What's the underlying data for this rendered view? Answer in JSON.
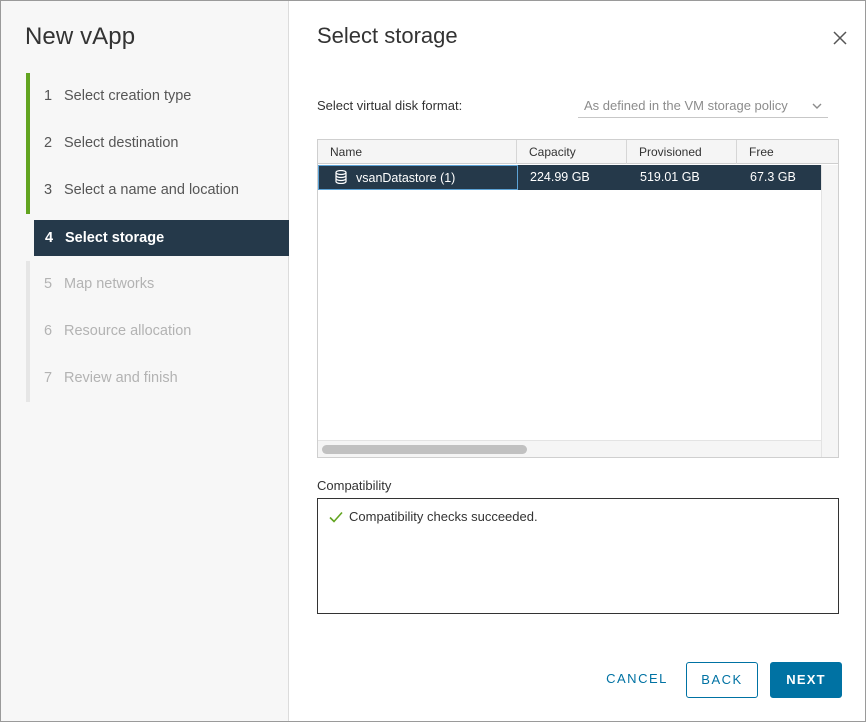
{
  "sidebar": {
    "title": "New vApp",
    "steps": [
      {
        "num": "1",
        "label": "Select creation type"
      },
      {
        "num": "2",
        "label": "Select destination"
      },
      {
        "num": "3",
        "label": "Select a name and location"
      },
      {
        "num": "4",
        "label": "Select storage"
      },
      {
        "num": "5",
        "label": "Map networks"
      },
      {
        "num": "6",
        "label": "Resource allocation"
      },
      {
        "num": "7",
        "label": "Review and finish"
      }
    ]
  },
  "main": {
    "title": "Select storage",
    "format_label": "Select virtual disk format:",
    "format_value": "As defined in the VM storage policy",
    "grid": {
      "columns": [
        "Name",
        "Capacity",
        "Provisioned",
        "Free"
      ],
      "rows": [
        {
          "name": "vsanDatastore (1)",
          "capacity": "224.99 GB",
          "provisioned": "519.01 GB",
          "free": "67.3 GB"
        }
      ]
    },
    "compatibility_label": "Compatibility",
    "compatibility_message": "Compatibility checks succeeded."
  },
  "footer": {
    "cancel": "CANCEL",
    "back": "BACK",
    "next": "NEXT"
  },
  "colors": {
    "accent": "#0072a3",
    "active_step_bg": "#25394a",
    "done_step_bar": "#62a420",
    "success": "#62a420"
  },
  "icons": {
    "close": "close-icon",
    "chevron": "chevron-down-icon",
    "datastore": "database-icon",
    "check": "check-icon"
  }
}
